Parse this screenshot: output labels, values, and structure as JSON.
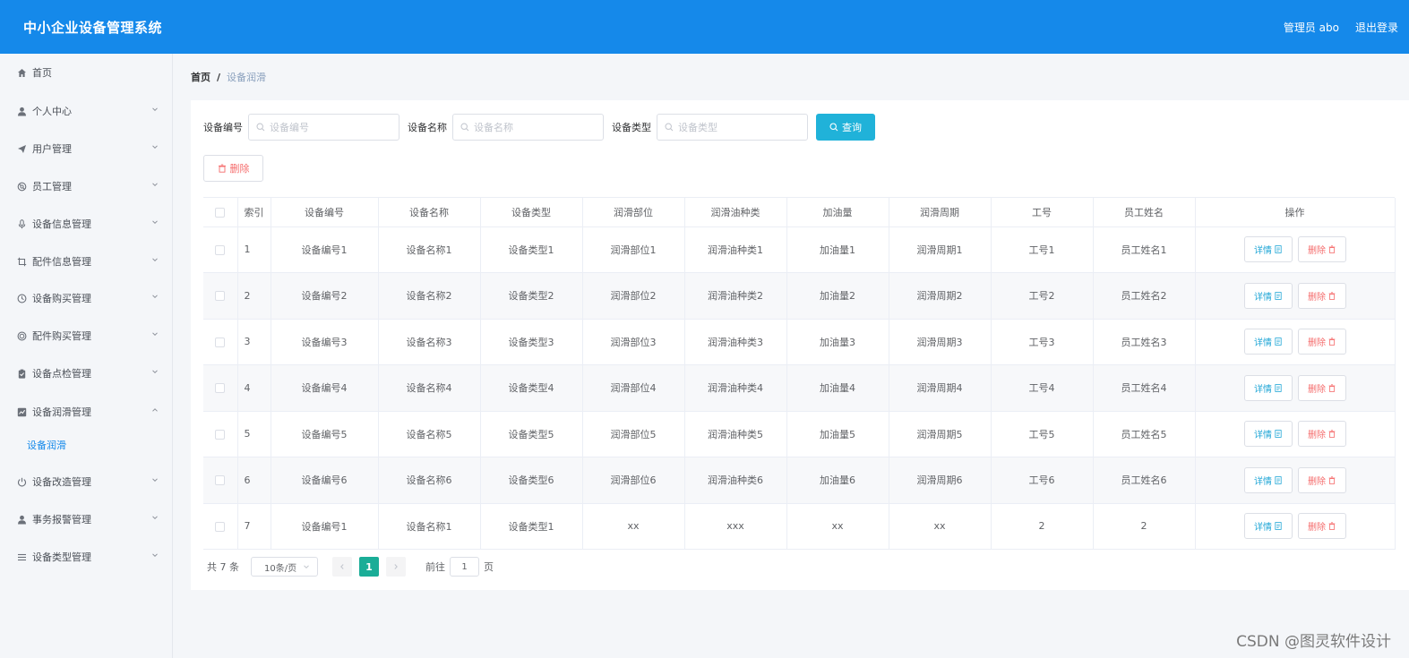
{
  "header": {
    "title": "中小企业设备管理系统",
    "user_label": "管理员 abo",
    "logout_label": "退出登录"
  },
  "sidebar": {
    "items": [
      {
        "label": "首页",
        "icon": "home-icon",
        "has_arrow": false
      },
      {
        "label": "个人中心",
        "icon": "user-icon",
        "has_arrow": true
      },
      {
        "label": "用户管理",
        "icon": "send-icon",
        "has_arrow": true
      },
      {
        "label": "员工管理",
        "icon": "life-ring-icon",
        "has_arrow": true
      },
      {
        "label": "设备信息管理",
        "icon": "microphone-icon",
        "has_arrow": true
      },
      {
        "label": "配件信息管理",
        "icon": "crop-icon",
        "has_arrow": true
      },
      {
        "label": "设备购买管理",
        "icon": "clock-icon",
        "has_arrow": true
      },
      {
        "label": "配件购买管理",
        "icon": "target-icon",
        "has_arrow": true
      },
      {
        "label": "设备点检管理",
        "icon": "clipboard-icon",
        "has_arrow": true
      },
      {
        "label": "设备润滑管理",
        "icon": "chart-icon",
        "has_arrow": true,
        "expanded": true
      },
      {
        "label": "设备改造管理",
        "icon": "power-icon",
        "has_arrow": true
      },
      {
        "label": "事务报警管理",
        "icon": "user-icon",
        "has_arrow": true
      },
      {
        "label": "设备类型管理",
        "icon": "list-icon",
        "has_arrow": true
      }
    ],
    "active_submenu": "设备润滑"
  },
  "breadcrumb": {
    "home": "首页",
    "separator": "/",
    "current": "设备润滑"
  },
  "search": {
    "fields": [
      {
        "label": "设备编号",
        "placeholder": "设备编号",
        "value": ""
      },
      {
        "label": "设备名称",
        "placeholder": "设备名称",
        "value": ""
      },
      {
        "label": "设备类型",
        "placeholder": "设备类型",
        "value": ""
      }
    ],
    "query_label": "查询"
  },
  "toolbar": {
    "delete_label": "删除"
  },
  "table": {
    "columns": [
      "索引",
      "设备编号",
      "设备名称",
      "设备类型",
      "润滑部位",
      "润滑油种类",
      "加油量",
      "润滑周期",
      "工号",
      "员工姓名",
      "操作"
    ],
    "detail_label": "详情",
    "delete_label": "删除",
    "rows": [
      [
        "1",
        "设备编号1",
        "设备名称1",
        "设备类型1",
        "润滑部位1",
        "润滑油种类1",
        "加油量1",
        "润滑周期1",
        "工号1",
        "员工姓名1"
      ],
      [
        "2",
        "设备编号2",
        "设备名称2",
        "设备类型2",
        "润滑部位2",
        "润滑油种类2",
        "加油量2",
        "润滑周期2",
        "工号2",
        "员工姓名2"
      ],
      [
        "3",
        "设备编号3",
        "设备名称3",
        "设备类型3",
        "润滑部位3",
        "润滑油种类3",
        "加油量3",
        "润滑周期3",
        "工号3",
        "员工姓名3"
      ],
      [
        "4",
        "设备编号4",
        "设备名称4",
        "设备类型4",
        "润滑部位4",
        "润滑油种类4",
        "加油量4",
        "润滑周期4",
        "工号4",
        "员工姓名4"
      ],
      [
        "5",
        "设备编号5",
        "设备名称5",
        "设备类型5",
        "润滑部位5",
        "润滑油种类5",
        "加油量5",
        "润滑周期5",
        "工号5",
        "员工姓名5"
      ],
      [
        "6",
        "设备编号6",
        "设备名称6",
        "设备类型6",
        "润滑部位6",
        "润滑油种类6",
        "加油量6",
        "润滑周期6",
        "工号6",
        "员工姓名6"
      ],
      [
        "7",
        "设备编号1",
        "设备名称1",
        "设备类型1",
        "xx",
        "xxx",
        "xx",
        "xx",
        "2",
        "2"
      ]
    ]
  },
  "pagination": {
    "total_label": "共 7 条",
    "page_size_label": "10条/页",
    "current_page": "1",
    "goto_prefix": "前往",
    "goto_value": "1",
    "goto_suffix": "页"
  },
  "watermark": "CSDN @图灵软件设计",
  "colors": {
    "header_bg": "#1589ea",
    "query_button": "#20b2d9",
    "active_page": "#1aad97",
    "danger": "#f56c6c"
  }
}
